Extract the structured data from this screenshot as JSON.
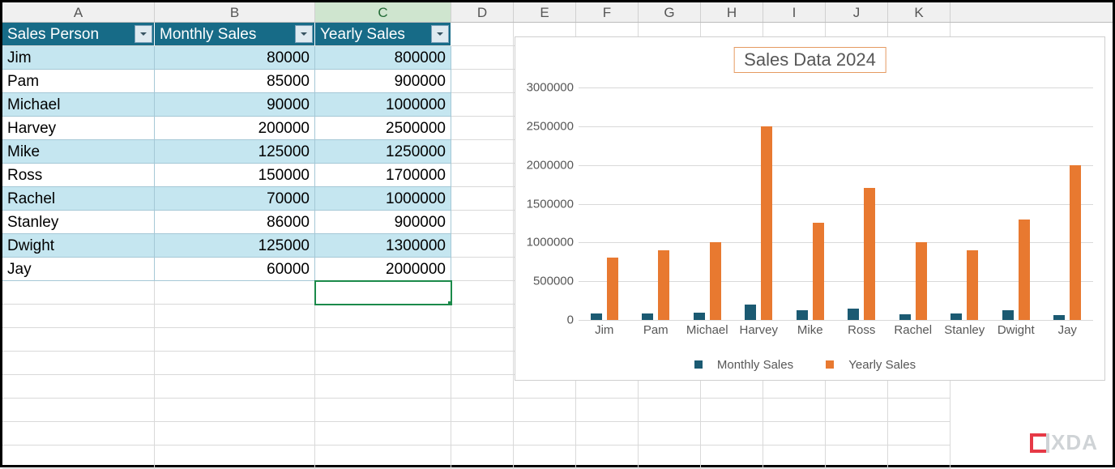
{
  "columns": [
    "A",
    "B",
    "C",
    "D",
    "E",
    "F",
    "G",
    "H",
    "I",
    "J",
    "K"
  ],
  "selected_column": "C",
  "table": {
    "headers": [
      "Sales Person",
      "Monthly Sales",
      "Yearly Sales"
    ],
    "rows": [
      {
        "person": "Jim",
        "monthly": 80000,
        "yearly": 800000
      },
      {
        "person": "Pam",
        "monthly": 85000,
        "yearly": 900000
      },
      {
        "person": "Michael",
        "monthly": 90000,
        "yearly": 1000000
      },
      {
        "person": "Harvey",
        "monthly": 200000,
        "yearly": 2500000
      },
      {
        "person": "Mike",
        "monthly": 125000,
        "yearly": 1250000
      },
      {
        "person": "Ross",
        "monthly": 150000,
        "yearly": 1700000
      },
      {
        "person": "Rachel",
        "monthly": 70000,
        "yearly": 1000000
      },
      {
        "person": "Stanley",
        "monthly": 86000,
        "yearly": 900000
      },
      {
        "person": "Dwight",
        "monthly": 125000,
        "yearly": 1300000
      },
      {
        "person": "Jay",
        "monthly": 60000,
        "yearly": 2000000
      }
    ]
  },
  "chart_data": {
    "type": "bar",
    "title": "Sales Data 2024",
    "categories": [
      "Jim",
      "Pam",
      "Michael",
      "Harvey",
      "Mike",
      "Ross",
      "Rachel",
      "Stanley",
      "Dwight",
      "Jay"
    ],
    "series": [
      {
        "name": "Monthly Sales",
        "color": "#1b5a72",
        "values": [
          80000,
          85000,
          90000,
          200000,
          125000,
          150000,
          70000,
          86000,
          125000,
          60000
        ]
      },
      {
        "name": "Yearly Sales",
        "color": "#e87930",
        "values": [
          800000,
          900000,
          1000000,
          2500000,
          1250000,
          1700000,
          1000000,
          900000,
          1300000,
          2000000
        ]
      }
    ],
    "ylim": [
      0,
      3000000
    ],
    "yticks": [
      0,
      500000,
      1000000,
      1500000,
      2000000,
      2500000,
      3000000
    ],
    "xlabel": "",
    "ylabel": ""
  },
  "logo_text": "XDA"
}
